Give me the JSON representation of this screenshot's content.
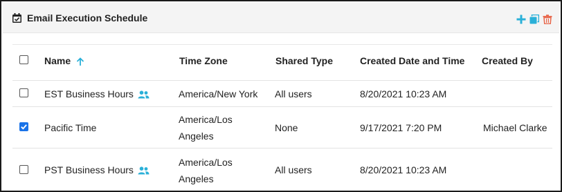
{
  "panel": {
    "title": "Email Execution Schedule",
    "actions": [
      {
        "name": "add",
        "icon": "plus-icon",
        "color": "#2ab0d8"
      },
      {
        "name": "copy",
        "icon": "copy-icon",
        "color": "#2ab0d8"
      },
      {
        "name": "delete",
        "icon": "trash-icon",
        "color": "#e8664a"
      }
    ]
  },
  "table": {
    "columns": [
      "Name",
      "Time Zone",
      "Shared Type",
      "Created Date and Time",
      "Created By"
    ],
    "sort": {
      "column": "Name",
      "direction": "ascending",
      "icon": "arrow-up-icon",
      "color": "#2ab0d8"
    },
    "header_checked": false,
    "rows": [
      {
        "checked": false,
        "name": "EST Business Hours",
        "shared_icon": true,
        "tz_line1": "America/New York",
        "tz_line2": "",
        "shared_type": "All users",
        "created": "8/20/2021 10:23 AM",
        "created_by": ""
      },
      {
        "checked": true,
        "name": "Pacific Time",
        "shared_icon": false,
        "tz_line1": "America/Los",
        "tz_line2": "Angeles",
        "shared_type": "None",
        "created": "9/17/2021 7:20 PM",
        "created_by": "Michael Clarke"
      },
      {
        "checked": false,
        "name": "PST Business Hours",
        "shared_icon": true,
        "tz_line1": "America/Los",
        "tz_line2": "Angeles",
        "shared_type": "All users",
        "created": "8/20/2021 10:23 AM",
        "created_by": ""
      }
    ]
  }
}
